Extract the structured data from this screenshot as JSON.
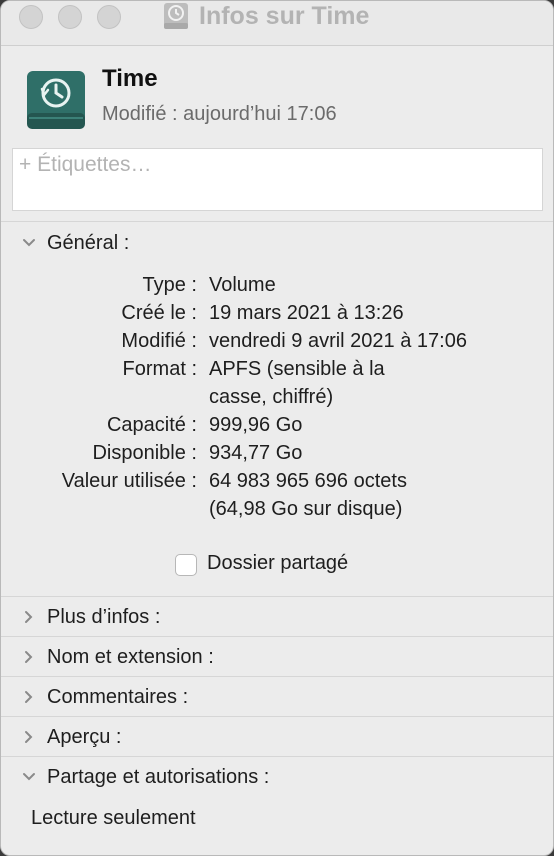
{
  "window": {
    "title": "Infos sur Time"
  },
  "header": {
    "name": "Time",
    "modified": "Modifié : aujourd’hui 17:06",
    "tags_placeholder": "+ Étiquettes…"
  },
  "general": {
    "label": "Général :",
    "rows": [
      {
        "label": "Type :",
        "value": "Volume"
      },
      {
        "label": "Créé le :",
        "value": "19 mars 2021 à 13:26"
      },
      {
        "label": "Modifié :",
        "value": "vendredi 9 avril 2021 à 17:06"
      },
      {
        "label": "Format :",
        "value": "APFS (sensible à la",
        "value2": "casse, chiffré)"
      },
      {
        "label": "Capacité :",
        "value": "999,96 Go"
      },
      {
        "label": "Disponible :",
        "value": "934,77 Go"
      },
      {
        "label": "Valeur utilisée :",
        "value": "64 983 965 696 octets",
        "value2": "(64,98 Go sur disque)"
      }
    ],
    "shared_folder": {
      "label": "Dossier partagé",
      "checked": false
    }
  },
  "sections": {
    "more_info": "Plus d’infos :",
    "name_ext": "Nom et extension :",
    "comments": "Commentaires :",
    "preview": "Aperçu :",
    "sharing": "Partage et autorisations :"
  },
  "sharing": {
    "status": "Lecture seulement"
  },
  "colors": {
    "window_bg": "#ececec",
    "icon_teal": "#2f6f68",
    "muted_text": "#6b6b6b"
  }
}
